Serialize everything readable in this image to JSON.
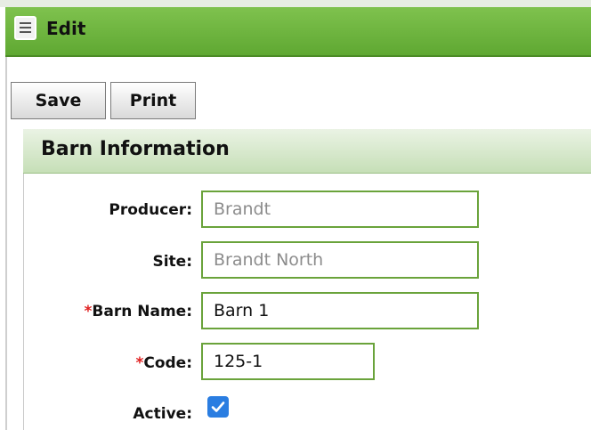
{
  "window": {
    "title": "Edit"
  },
  "toolbar": {
    "save_label": "Save",
    "print_label": "Print"
  },
  "section": {
    "title": "Barn Information"
  },
  "form": {
    "producer": {
      "label": "Producer:",
      "value": "Brandt"
    },
    "site": {
      "label": "Site:",
      "value": "Brandt North"
    },
    "barn_name": {
      "required_mark": "*",
      "label": "Barn Name:",
      "value": "Barn 1"
    },
    "code": {
      "required_mark": "*",
      "label": "Code:",
      "value": "125-1"
    },
    "active": {
      "label": "Active:",
      "checked": true
    }
  },
  "colors": {
    "titlebar": "#6db73f",
    "section_header": "#d4e8c8",
    "field_border": "#6aa33b",
    "checkbox": "#2a7de1",
    "required": "#e02020"
  }
}
